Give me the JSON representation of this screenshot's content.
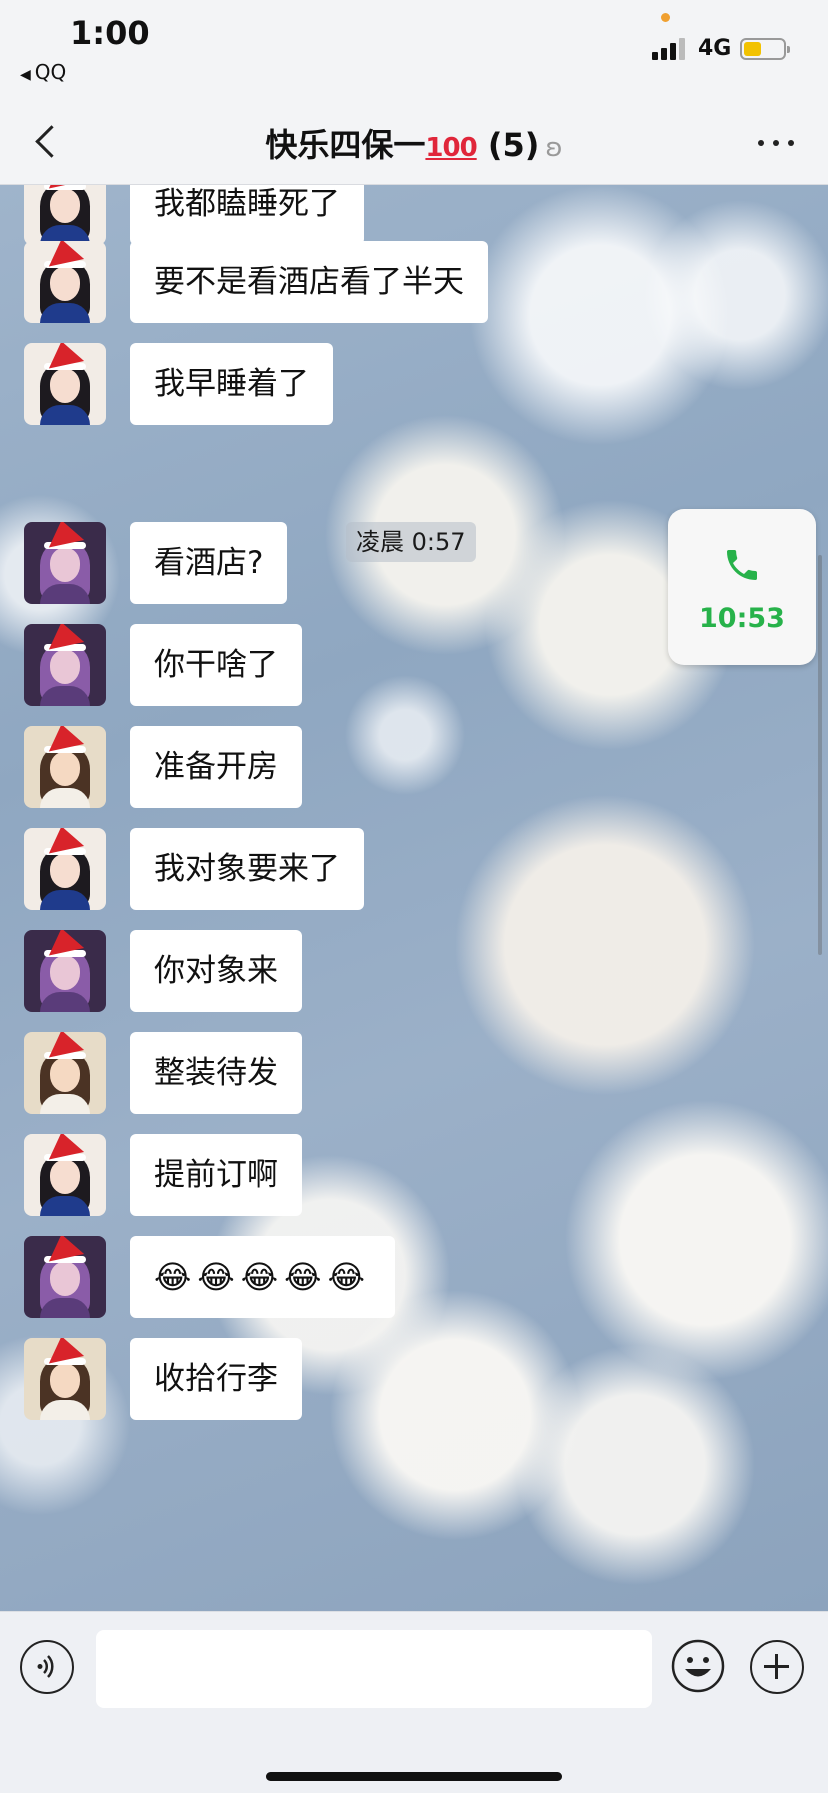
{
  "status_bar": {
    "time": "1:00",
    "back_app": "QQ",
    "network": "4G",
    "battery_level": 0.45,
    "signal_bars": 3
  },
  "nav": {
    "title": "快乐四保一",
    "title_emoji": "100",
    "member_count": "(5)"
  },
  "timestamp": "凌晨 0:57",
  "call_card": {
    "duration": "10:53",
    "icon": "phone-icon",
    "color": "#27b24a"
  },
  "messages": [
    {
      "avatar": "snow-white-avatar",
      "text": "我都瞌睡死了"
    },
    {
      "avatar": "snow-white-avatar",
      "text": "要不是看酒店看了半天"
    },
    {
      "avatar": "snow-white-avatar",
      "text": "我早睡着了"
    },
    {
      "avatar": "fox-girl-avatar",
      "text": "看酒店?"
    },
    {
      "avatar": "fox-girl-avatar",
      "text": "你干啥了"
    },
    {
      "avatar": "girl-photo-avatar",
      "text": "准备开房"
    },
    {
      "avatar": "snow-white-avatar",
      "text": "我对象要来了"
    },
    {
      "avatar": "fox-girl-avatar",
      "text": "你对象来"
    },
    {
      "avatar": "girl-photo-avatar",
      "text": "整装待发"
    },
    {
      "avatar": "snow-white-avatar",
      "text": "提前订啊"
    },
    {
      "avatar": "fox-girl-avatar",
      "text": "😂😂😂😂😂"
    },
    {
      "avatar": "girl-photo-avatar",
      "text": "收拾行李"
    }
  ],
  "input_bar": {
    "placeholder": "",
    "icons": [
      "voice-icon",
      "emoji-icon",
      "plus-icon"
    ]
  }
}
